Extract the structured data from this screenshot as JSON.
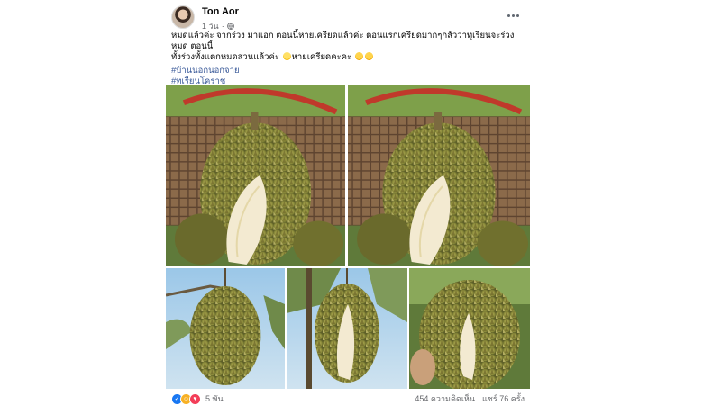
{
  "post": {
    "author": "Ton Aor",
    "time": "1 วัน",
    "text_line1": "หมดแล้วค่ะ จากร่วง มาแอก  ตอนนี้หายเครียดแล้วค่ะ   ตอนแรกเครียดมากๆกลัวว่าทุเรียนจะร่วงหมด ตอนนี้",
    "text_line2": "ทั้งร่วงทั้งแตกหมดสวนแล้วค่ะ",
    "text_line2_suffix": "หายเครียดคะคะ",
    "hashtags": [
      "#บ้านนอกนอกจาย",
      "#ทเรียนโคราช"
    ],
    "photos": [
      {
        "name": "durian-photo-1"
      },
      {
        "name": "durian-photo-2"
      },
      {
        "name": "durian-photo-3"
      },
      {
        "name": "durian-photo-4"
      },
      {
        "name": "durian-photo-5"
      }
    ]
  },
  "footer": {
    "reaction_count": "5 พัน",
    "comments": "454 ความคิดเห็น",
    "shares": "แชร์ 76 ครั้ง"
  },
  "icons": [
    "globe-icon",
    "more-icon",
    "like-reaction-icon",
    "haha-reaction-icon",
    "love-reaction-icon"
  ],
  "colors": {
    "hashtag": "#385898",
    "meta": "#65676b",
    "like": "#1877f2"
  }
}
